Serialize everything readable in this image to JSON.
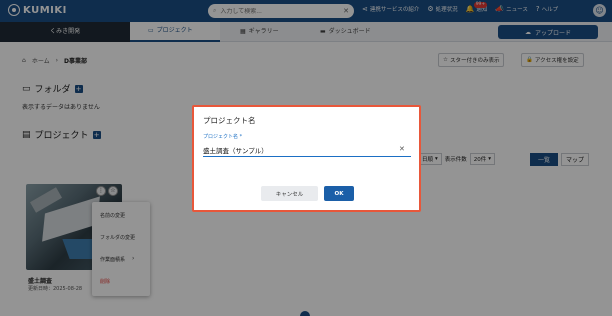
{
  "header": {
    "logo": "KUMIKI",
    "search_placeholder": "入力して検索...",
    "links": [
      {
        "icon": "share-icon",
        "glyph": "⋖",
        "label": "連携サービスの紹介"
      },
      {
        "icon": "gear-icon",
        "glyph": "⚙",
        "label": "処理状況"
      },
      {
        "icon": "bell-icon",
        "glyph": "🔔",
        "label": "通知",
        "badge": "99+"
      },
      {
        "icon": "megaphone-icon",
        "glyph": "📣",
        "label": "ニュース"
      },
      {
        "icon": "help-icon",
        "glyph": "?",
        "label": "ヘルプ"
      }
    ]
  },
  "nav": {
    "home": "くみき開発",
    "tabs": [
      {
        "label": "プロジェクト",
        "icon": "folder-icon",
        "active": true
      },
      {
        "label": "ギャラリー",
        "icon": "grid-icon",
        "active": false
      },
      {
        "label": "ダッシュボード",
        "icon": "monitor-icon",
        "active": false
      }
    ],
    "upload": "アップロード"
  },
  "breadcrumb": {
    "home": "ホーム",
    "current": "D事業部"
  },
  "toolbar": {
    "starred_only": "スター付きのみ表示",
    "access": "アクセス権を設定"
  },
  "folder_section": {
    "title": "フォルダ",
    "empty": "表示するデータはありません"
  },
  "project_section": {
    "title": "プロジェクト"
  },
  "controls": {
    "sort_value": "日順",
    "per_page_label": "表示件数",
    "per_page_value": "20件",
    "view_list": "一覧",
    "view_map": "マップ"
  },
  "card": {
    "title": "盛土調査",
    "date": "更新日時：2025-08-28"
  },
  "context_menu": [
    {
      "label": "名前の変更"
    },
    {
      "label": "フォルダの変更"
    },
    {
      "label": "作業面積系"
    },
    {
      "label": "削除"
    }
  ],
  "dialog": {
    "title": "プロジェクト名",
    "field_label": "プロジェクト名 *",
    "field_value": "盛土調査（サンプル）",
    "cancel": "キャンセル",
    "ok": "OK"
  },
  "colors": {
    "primary": "#1b4f86",
    "accent_border": "#e8573a",
    "danger": "#e53935"
  }
}
